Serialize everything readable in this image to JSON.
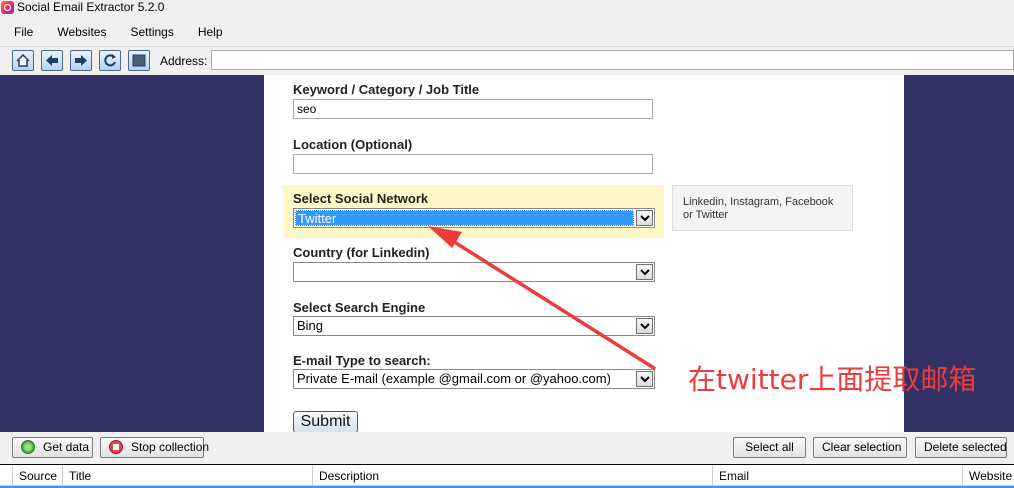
{
  "window": {
    "title": "Social Email Extractor 5.2.0"
  },
  "menu": [
    "File",
    "Websites",
    "Settings",
    "Help"
  ],
  "toolbar": {
    "buttons": [
      "home-icon",
      "back-arrow-icon",
      "forward-arrow-icon",
      "refresh-icon",
      "stop-square-icon"
    ],
    "address_label": "Address:",
    "address_value": ""
  },
  "form": {
    "keyword": {
      "label": "Keyword / Category / Job Title",
      "value": "seo"
    },
    "location": {
      "label": "Location (Optional)",
      "value": ""
    },
    "social_network": {
      "label": "Select Social Network",
      "value": "Twitter",
      "hint": "Linkedin, Instagram, Facebook or Twitter"
    },
    "country": {
      "label": "Country (for Linkedin)",
      "value": ""
    },
    "search_engine": {
      "label": "Select Search Engine",
      "value": "Bing"
    },
    "email_type": {
      "label": "E-mail Type to search:",
      "value": "Private E-mail (example @gmail.com or @yahoo.com)"
    },
    "submit_label": "Submit"
  },
  "annotation": {
    "text": "在twitter上面提取邮箱",
    "color": "#ee3b3b"
  },
  "bottom": {
    "get_data": "Get data",
    "stop_collection": "Stop collection",
    "select_all": "Select all",
    "clear_selection": "Clear selection",
    "delete_selected": "Delete selected"
  },
  "grid": {
    "columns": [
      "Source",
      "Title",
      "Description",
      "Email",
      "Website L"
    ]
  },
  "colors": {
    "background": "#323266",
    "highlight": "#fff8c6",
    "selection": "#3399ff"
  }
}
